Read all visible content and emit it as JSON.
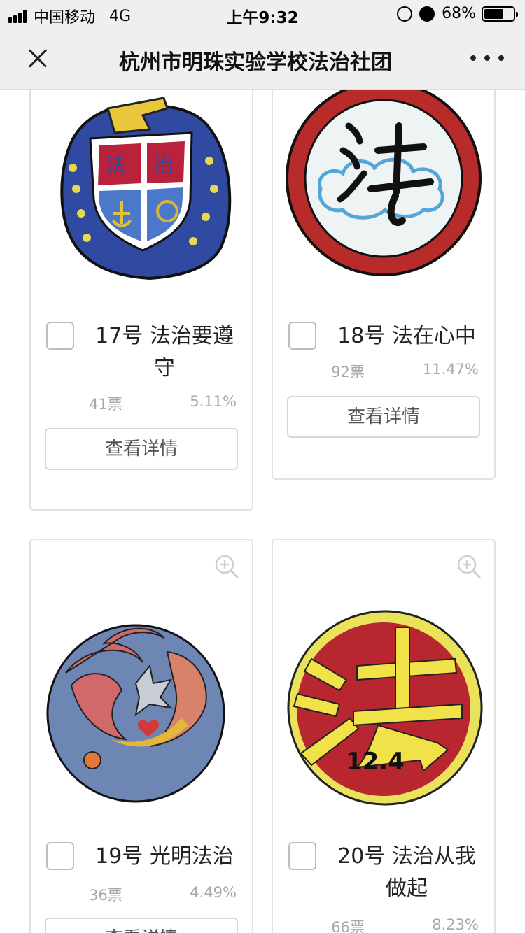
{
  "status_bar": {
    "carrier": "中国移动",
    "network": "4G",
    "time": "上午9:32",
    "battery": "68%",
    "battery_level": 0.68
  },
  "nav": {
    "title": "杭州市明珠实验学校法治社团"
  },
  "detail_button_label": "查看详情",
  "cards": [
    {
      "number_title": "17号 法治要遵守",
      "votes": "41票",
      "percent": "5.11%",
      "image_icon": "badge-shield-icon"
    },
    {
      "number_title": "18号 法在心中",
      "votes": "92票",
      "percent": "11.47%",
      "image_icon": "badge-cloud-fa-icon"
    },
    {
      "number_title": "19号 光明法治",
      "votes": "36票",
      "percent": "4.49%",
      "image_icon": "badge-swirl-heart-icon"
    },
    {
      "number_title": "20号 法治从我做起",
      "votes": "66票",
      "percent": "8.23%",
      "image_icon": "badge-fa-12-4-icon",
      "badge_text": "12.4",
      "badge_char": "法"
    }
  ],
  "colors": {
    "bar_bg": "#efefef",
    "card_border": "#e2e2e2",
    "muted_text": "#a8a8a8"
  }
}
